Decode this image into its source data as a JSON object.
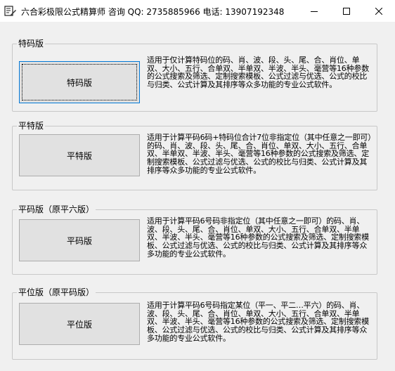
{
  "window": {
    "title": "六合彩极限公式精算师  咨询 QQ: 2735885966 电话: 13907192348",
    "icon": "app-icon",
    "controls": [
      "minimize-icon",
      "maximize-icon",
      "close-icon"
    ]
  },
  "groups": [
    {
      "legend": "特码版",
      "button_label": "特码版",
      "description": "适用于仅计算特码位的码、肖、波、段、头、尾、合、肖位、单双、大小、五行、合单双、半单双、半波、半头、毫营等16种参数的公式搜索及筛选、定制搜索模板、公式过滤与优选、公式的校比与归类、公式计算及其排序等众多功能的专业公式软件。"
    },
    {
      "legend": "平特版",
      "button_label": "平特版",
      "description": "适用于计算平码6码+特码位合计7位非指定位（其中任意之一即可）的码、肖、波、段、头、尾、合、肖位、单双、大小、五行、合单双、半单双、半波、半头、毫营等16种参数的公式搜索及筛选、定制搜索模板、公式过滤与优选、公式的校比与归类、公式计算及其排序等众多功能的专业公式软件。"
    },
    {
      "legend": "平码版（原平六版）",
      "button_label": "平码版",
      "description": "适用于计算平码6号码非指定位（其中任意之一即可）的码、肖、波、段、头、尾、合、肖位、单双、大小、五行、合单双、半单双、半波、半头、毫营等16种参数的公式搜索及筛选、定制搜索模板、公式过滤与优选、公式的校比与归类、公式计算及其排序等众多功能的专业公式软件。"
    },
    {
      "legend": "平位版（原平码版）",
      "button_label": "平位版",
      "description": "适用于计算平码6号码指定某位（平一、平二…平六）的码、肖、波、段、头、尾、合、肖位、单双、大小、五行、合单双、半单双、半波、半头、毫营等16种参数的公式搜索及筛选、定制搜索模板、公式过滤与优选、公式的校比与归类、公式计算及其排序等众多功能的专业公式软件。"
    }
  ]
}
